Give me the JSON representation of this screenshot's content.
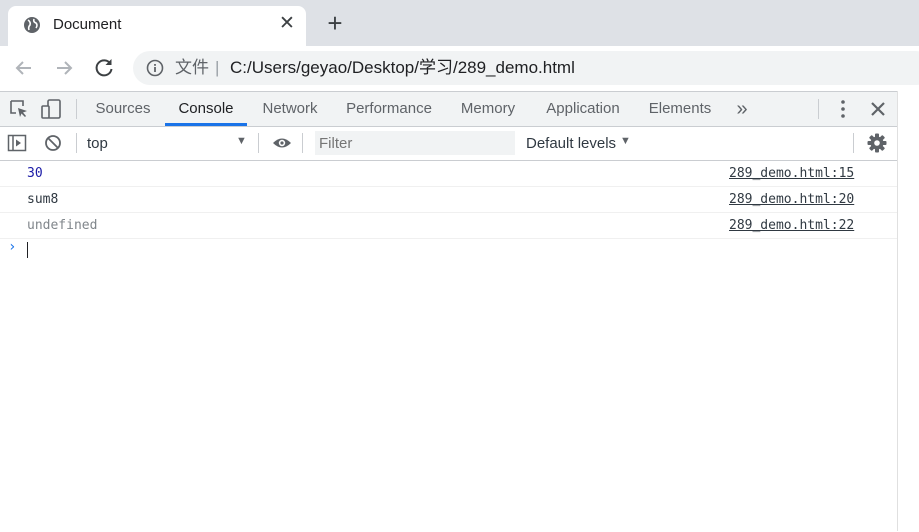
{
  "browser": {
    "tab_title": "Document",
    "tab_close": "✕",
    "new_tab": "+",
    "url_scheme_label": "文件",
    "url_separator": "|",
    "url": "C:/Users/geyao/Desktop/学习/289_demo.html"
  },
  "devtools": {
    "tabs": [
      {
        "label": "Sources",
        "active": false
      },
      {
        "label": "Console",
        "active": true
      },
      {
        "label": "Network",
        "active": false
      },
      {
        "label": "Performance",
        "active": false
      },
      {
        "label": "Memory",
        "active": false
      },
      {
        "label": "Application",
        "active": false
      },
      {
        "label": "Elements",
        "active": false
      }
    ],
    "more_tabs": "»",
    "context": "top",
    "filter_placeholder": "Filter",
    "levels": "Default levels",
    "accent_color": "#1a73e8"
  },
  "console": {
    "messages": [
      {
        "text": "30",
        "source": "289_demo.html:15",
        "color": "#1a1aa6"
      },
      {
        "text": "sum8",
        "source": "289_demo.html:20",
        "color": "#303942"
      },
      {
        "text": "undefined",
        "source": "289_demo.html:22",
        "color": "#80868b"
      }
    ],
    "prompt": "›"
  }
}
